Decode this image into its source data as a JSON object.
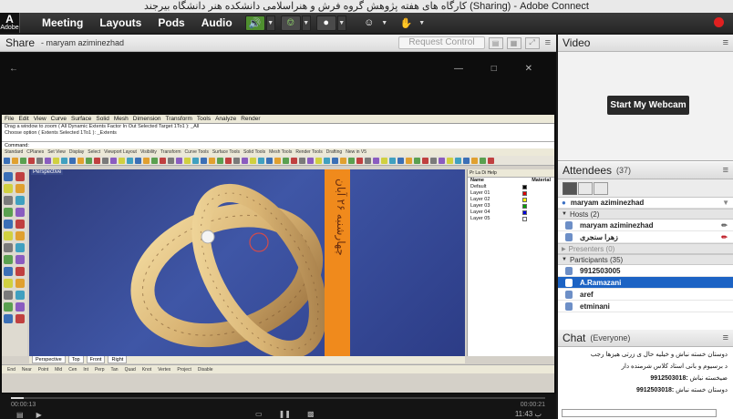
{
  "window_title": "کارگاه های هفته پژوهش گروه فرش و هنراسلامی دانشکده هنر دانشگاه بیرجند (Sharing) - Adobe Connect",
  "logo": {
    "mark": "A",
    "text": "Adobe"
  },
  "menu": {
    "meeting": "Meeting",
    "layouts": "Layouts",
    "pods": "Pods",
    "audio": "Audio"
  },
  "colors": {
    "accent": "#1c63c4",
    "speaker_active": "#4f8f2f",
    "record": "#e02020",
    "orange_bar": "#f08a1c"
  },
  "share": {
    "title": "Share",
    "presenter": "- maryam aziminezhad",
    "request_control": "Request Control",
    "window_controls": "—  □  ✕",
    "rhino": {
      "menu": [
        "File",
        "Edit",
        "View",
        "Curve",
        "Surface",
        "Solid",
        "Mesh",
        "Dimension",
        "Transform",
        "Tools",
        "Analyze",
        "Render"
      ],
      "cmd_line_1": "Drag a window to zoom ( All  Dynamic  Extents  Factor  In  Out  Selected  Target  1To1 ): _All",
      "cmd_line_2": "Choose option ( Extents  Selected  1To1 ): _Extents",
      "cmd_prompt": "Command:",
      "toolbar_tabs": [
        "Standard",
        "CPlanes",
        "Set View",
        "Display",
        "Select",
        "Viewport Layout",
        "Visibility",
        "Transform",
        "Curve Tools",
        "Surface Tools",
        "Solid Tools",
        "Mesh Tools",
        "Render Tools",
        "Drafting",
        "New in V5"
      ],
      "viewport_label": "Perspective",
      "overlay_text": "چهارشنبه ۲۶ آبان",
      "panel_tabs": "Pr  La  Di  Help",
      "layer_header": {
        "name": "Name",
        "material": "Material"
      },
      "layers": [
        "Default",
        "Layer 01",
        "Layer 02",
        "Layer 03",
        "Layer 04",
        "Layer 05"
      ],
      "layer_colors": [
        "#000000",
        "#e00000",
        "#ffff00",
        "#00a000",
        "#0000e0",
        "#ffffff"
      ],
      "viewport_tabs": [
        "Perspective",
        "Top",
        "Front",
        "Right"
      ],
      "osnaps": [
        "End",
        "Near",
        "Point",
        "Mid",
        "Cen",
        "Int",
        "Perp",
        "Tan",
        "Quad",
        "Knot",
        "Vertex",
        "Project",
        "Disable"
      ]
    },
    "player": {
      "time_elapsed": "00:00:13",
      "time_total": "00:00:21",
      "clock": "11:43 ب"
    }
  },
  "video_pod": {
    "title": "Video",
    "start_webcam": "Start My Webcam"
  },
  "attendees": {
    "title": "Attendees",
    "count": "(37)",
    "current_user": "maryam aziminezhad",
    "hosts_label": "Hosts (2)",
    "hosts": [
      "maryam aziminezhad",
      "زهرا سنجری"
    ],
    "presenters_label": "Presenters (0)",
    "participants_label": "Participants (35)",
    "participants": [
      "9912503005",
      "A.Ramazani",
      "aref",
      "etminani"
    ],
    "selected_participant": "A.Ramazani"
  },
  "chat": {
    "title": "Chat",
    "scope": "(Everyone)",
    "messages": [
      {
        "sender": "",
        "text": "دوستان خسته نباش و خیلیه حال ی زرتی هیزها رجب"
      },
      {
        "sender": "",
        "text": "د برسیوم و بانی استاد کلاس شرمنده دار"
      },
      {
        "sender": "9912503018:",
        "text": "ضیخسته نباش"
      },
      {
        "sender": "9912503018:",
        "text": "دوستان خسته نباش"
      }
    ]
  }
}
